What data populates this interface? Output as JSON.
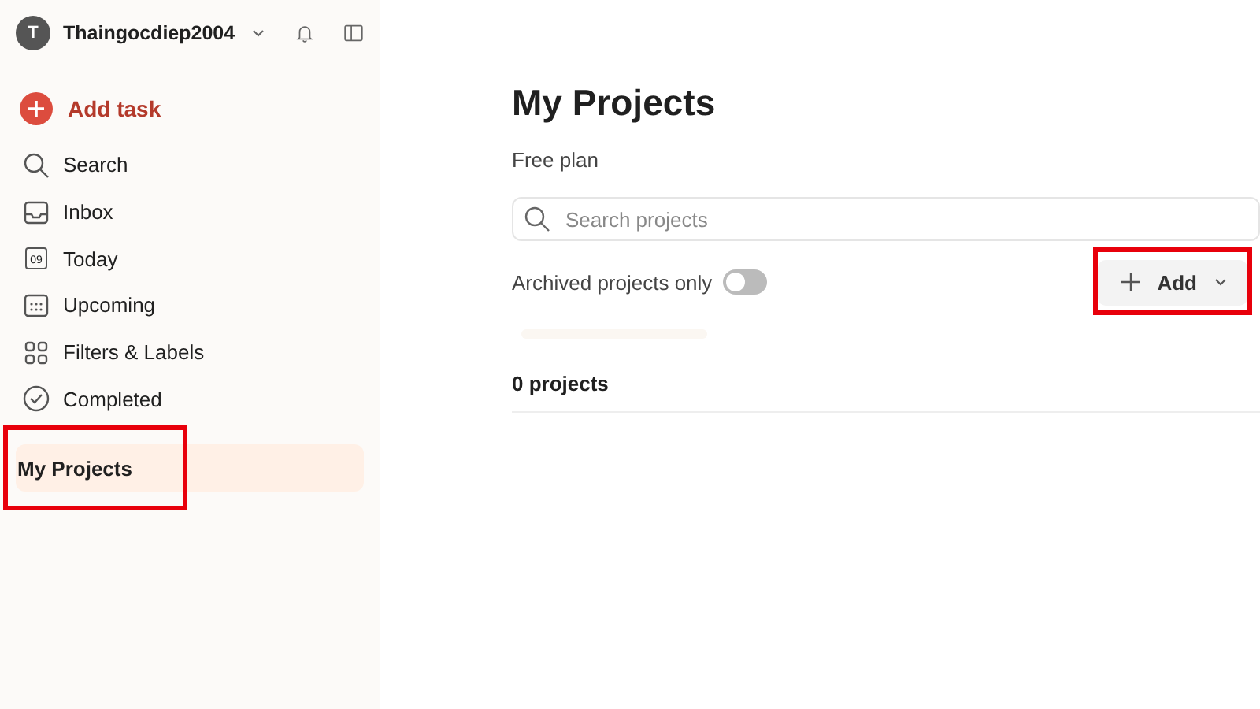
{
  "sidebar": {
    "user": {
      "initial": "T",
      "name": "Thaingocdiep2004"
    },
    "add_task": "Add task",
    "items": [
      {
        "kind": "search",
        "label": "Search"
      },
      {
        "kind": "inbox",
        "label": "Inbox"
      },
      {
        "kind": "today",
        "label": "Today",
        "day": "09"
      },
      {
        "kind": "upcoming",
        "label": "Upcoming"
      },
      {
        "kind": "filters",
        "label": "Filters & Labels"
      },
      {
        "kind": "completed",
        "label": "Completed"
      }
    ],
    "projects": {
      "label": "My Projects",
      "selected": true,
      "highlighted": true
    }
  },
  "main": {
    "title": "My Projects",
    "plan": "Free plan",
    "search": {
      "placeholder": "Search projects"
    },
    "archived": {
      "label": "Archived projects only",
      "on": false
    },
    "add_button": {
      "label": "Add",
      "highlighted": true
    },
    "count": "0 projects"
  }
}
